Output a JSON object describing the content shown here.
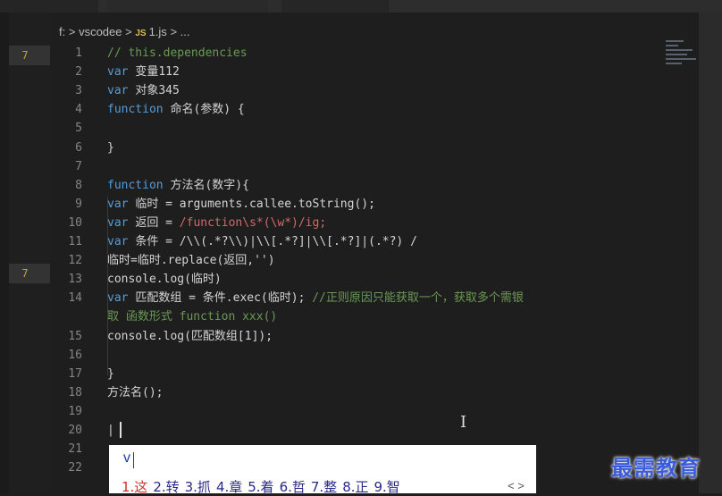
{
  "breadcrumb": {
    "root": "f:",
    "sep": ">",
    "folder": "vscodee",
    "js_badge": "JS",
    "file": "1.js",
    "more": "..."
  },
  "gutter": {
    "marker_1": "7",
    "marker_2": "7"
  },
  "lines": [
    {
      "n": "1",
      "parts": [
        {
          "c": "cm",
          "t": "// this.dependencies"
        }
      ]
    },
    {
      "n": "2",
      "parts": [
        {
          "c": "kw",
          "t": "var "
        },
        {
          "c": "id",
          "t": "变量112"
        }
      ]
    },
    {
      "n": "3",
      "parts": [
        {
          "c": "kw",
          "t": "var "
        },
        {
          "c": "id",
          "t": "对象345"
        }
      ]
    },
    {
      "n": "4",
      "parts": [
        {
          "c": "kw",
          "t": "function "
        },
        {
          "c": "id",
          "t": "命名(参数) {"
        }
      ]
    },
    {
      "n": "5",
      "parts": []
    },
    {
      "n": "6",
      "parts": [
        {
          "c": "id",
          "t": "}"
        }
      ]
    },
    {
      "n": "7",
      "parts": []
    },
    {
      "n": "8",
      "parts": [
        {
          "c": "kw",
          "t": "function "
        },
        {
          "c": "id",
          "t": "方法名(数字){"
        }
      ]
    },
    {
      "n": "9",
      "parts": [
        {
          "c": "kw",
          "t": "        var "
        },
        {
          "c": "id",
          "t": "临时 = arguments.callee.toString();"
        }
      ]
    },
    {
      "n": "10",
      "parts": [
        {
          "c": "kw",
          "t": "        var "
        },
        {
          "c": "id",
          "t": "返回 = "
        },
        {
          "c": "rx",
          "t": "/function\\s*(\\w*)/ig;"
        }
      ]
    },
    {
      "n": "11",
      "parts": [
        {
          "c": "kw",
          "t": "        var "
        },
        {
          "c": "id",
          "t": "条件 = "
        },
        {
          "c": "id",
          "t": "/\\\\(.*?\\\\)|\\\\[.*?]|\\\\[.*?]|(.*?) /"
        }
      ]
    },
    {
      "n": "12",
      "parts": [
        {
          "c": "id",
          "t": "        临时=临时.replace(返回,'')"
        }
      ]
    },
    {
      "n": "13",
      "parts": [
        {
          "c": "id",
          "t": "        console.log(临时)"
        }
      ]
    },
    {
      "n": "14",
      "parts": [
        {
          "c": "kw",
          "t": "        var "
        },
        {
          "c": "id",
          "t": "匹配数组 = 条件.exec(临时); "
        },
        {
          "c": "cm",
          "t": "//正则原因只能获取一个，获取多个需银"
        }
      ]
    },
    {
      "n": "",
      "parts": [
        {
          "c": "cm",
          "t": "        取 函数形式 function xxx()"
        }
      ]
    },
    {
      "n": "15",
      "parts": [
        {
          "c": "id",
          "t": "        console.log(匹配数组[1]);"
        }
      ]
    },
    {
      "n": "16",
      "parts": []
    },
    {
      "n": "17",
      "parts": [
        {
          "c": "id",
          "t": "}"
        }
      ]
    },
    {
      "n": "18",
      "parts": [
        {
          "c": "id",
          "t": "方法名();"
        }
      ]
    },
    {
      "n": "19",
      "parts": []
    },
    {
      "n": "20",
      "parts": [
        {
          "c": "id",
          "t": "|"
        }
      ]
    },
    {
      "n": "21",
      "parts": []
    },
    {
      "n": "22",
      "parts": []
    }
  ],
  "ime": {
    "composition": "v",
    "candidates": [
      "1.这",
      "2.转",
      "3.抓",
      "4.章",
      "5.着",
      "6.哲",
      "7.整",
      "8.正",
      "9.智"
    ],
    "pager": "< >"
  },
  "watermark": "最需教育"
}
